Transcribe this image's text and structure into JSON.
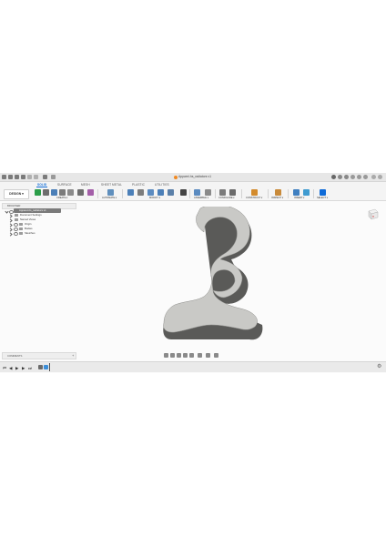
{
  "app": {
    "document_title": "Apparel-hs_radiators v1",
    "tabs": [
      {
        "label": "SOLID",
        "active": true
      },
      {
        "label": "SURFACE",
        "active": false
      },
      {
        "label": "MESH",
        "active": false
      },
      {
        "label": "SHEET METAL",
        "active": false
      },
      {
        "label": "PLASTIC",
        "active": false
      },
      {
        "label": "UTILITIES",
        "active": false
      }
    ],
    "workspace_button": "DESIGN ▾",
    "ribbon_groups": [
      {
        "label": "CREATE ▾"
      },
      {
        "label": "AUTOMATE ▾"
      },
      {
        "label": "MODIFY ▾"
      },
      {
        "label": "ASSEMBLE ▾"
      },
      {
        "label": "CONFIGURE ▾"
      },
      {
        "label": "CONSTRUCT ▾"
      },
      {
        "label": "INSPECT ▾"
      },
      {
        "label": "INSERT ▾"
      },
      {
        "label": "SELECT ▾"
      }
    ],
    "colors": {
      "accent": "#0e6bd8",
      "create_icon": "#2a9d48",
      "model_face": "#c9c9c6",
      "model_side": "#5a5a58",
      "timeline_item": "#3c8ed8"
    }
  },
  "browser": {
    "header": "BROWSER",
    "root": "Apparel-hs_radiators v1",
    "items": [
      {
        "label": "Document Settings"
      },
      {
        "label": "Named Views"
      },
      {
        "label": "Origin"
      },
      {
        "label": "Bodies"
      },
      {
        "label": "Sketches"
      }
    ]
  },
  "comments": {
    "label": "COMMENTS",
    "add": "+"
  },
  "timeline": {
    "controls": [
      "⏮",
      "◀",
      "▶",
      "▶",
      "⏭"
    ]
  }
}
